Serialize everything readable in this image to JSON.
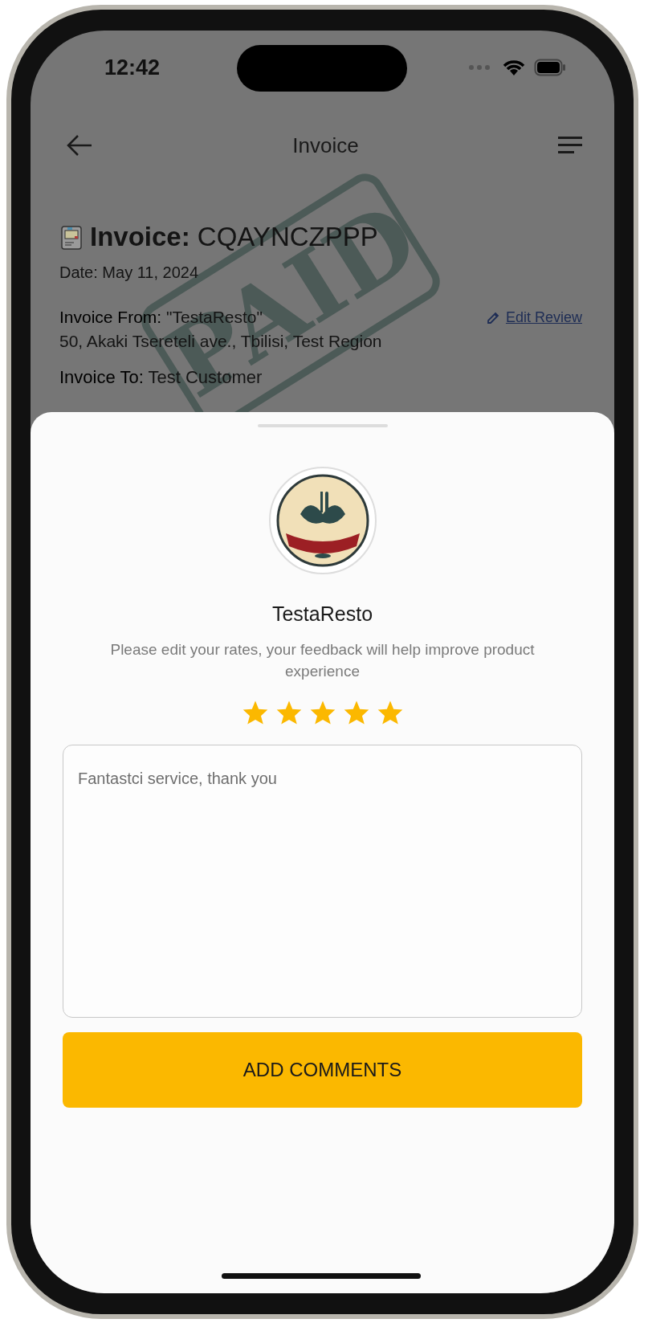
{
  "status_bar": {
    "time": "12:42"
  },
  "header": {
    "title": "Invoice"
  },
  "invoice": {
    "label": "Invoice:",
    "number": "CQAYNCZPPP",
    "date": "Date: May 11, 2024",
    "stamp": "PAID",
    "from_label": "Invoice From:",
    "from_name": "\"TestaResto\"",
    "from_address": "50, Akaki Tsereteli ave., Tbilisi, Test Region",
    "edit_link": "Edit Review",
    "to_label": "Invoice To:",
    "to_name": "Test Customer"
  },
  "review_sheet": {
    "restaurant": "TestaResto",
    "prompt": "Please edit your rates, your feedback will help improve product experience",
    "stars": 5,
    "comment": "Fantastci service, thank you",
    "button": "ADD COMMENTS"
  }
}
